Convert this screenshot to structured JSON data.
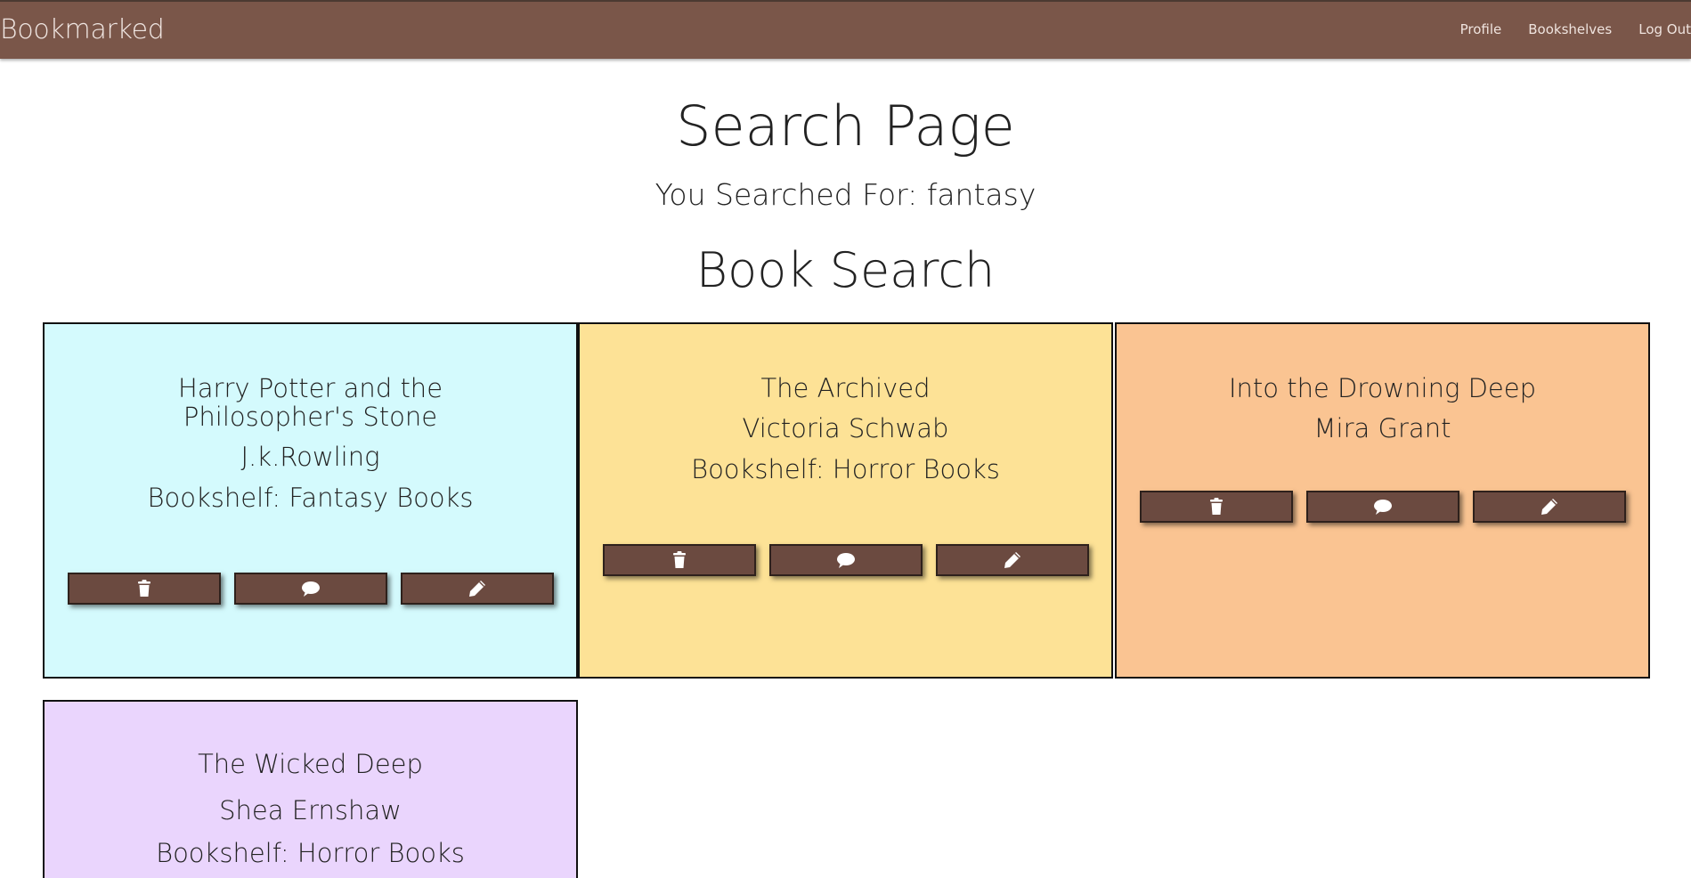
{
  "navbar": {
    "brand": "Bookmarked",
    "links": [
      "Profile",
      "Bookshelves",
      "Log Out"
    ]
  },
  "header": {
    "title": "Search Page",
    "search_text": "You Searched For: fantasy",
    "section_title": "Book Search"
  },
  "cards": [
    {
      "title": "Harry Potter and the Philosopher's Stone",
      "author": "J.k.Rowling",
      "shelf": "Bookshelf: Fantasy Books",
      "color": "#d4fafd"
    },
    {
      "title": "The Archived",
      "author": "Victoria Schwab",
      "shelf": "Bookshelf: Horror Books",
      "color": "#fde296"
    },
    {
      "title": "Into the Drowning Deep",
      "author": "Mira Grant",
      "shelf": "",
      "color": "#fac492"
    },
    {
      "title": "The Wicked Deep",
      "author": "Shea Ernshaw",
      "shelf": "Bookshelf: Horror Books",
      "color": "#ead5fd"
    }
  ],
  "card_actions": {
    "icons": [
      "trash-icon",
      "comment-icon",
      "pencil-icon"
    ]
  }
}
